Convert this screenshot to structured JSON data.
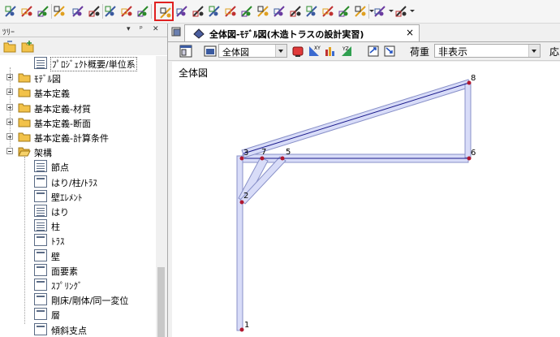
{
  "toolbar": {
    "buttons": [
      "grid-icon",
      "node-icon",
      "node-edit-icon",
      "delete-icon",
      "member-icon",
      "member-add-icon",
      "member-move-icon",
      "member-split-icon",
      "member-join-icon",
      "member-active-icon",
      "truss-icon",
      "brace-icon",
      "load-icon",
      "hinge-icon",
      "panel-icon",
      "arc-icon",
      "slab-icon",
      "view-icon",
      "section-icon",
      "load-case-icon",
      "print-icon",
      "property-icon",
      "axis-icon",
      "coord-icon"
    ],
    "active_index": 9
  },
  "tree_panel": {
    "title": "ﾂﾘｰ",
    "controls": [
      "▾",
      "ᵖ",
      "✕"
    ],
    "items": [
      {
        "label": "ﾌﾟﾛｼﾞｪｸﾄ概要/単位系",
        "level": 1,
        "type": "doc-lines",
        "expander": "none",
        "selected": true
      },
      {
        "label": "ﾓﾃﾞﾙ図",
        "level": 0,
        "type": "folder",
        "expander": "plus"
      },
      {
        "label": "基本定義",
        "level": 0,
        "type": "folder",
        "expander": "plus"
      },
      {
        "label": "基本定義-材質",
        "level": 0,
        "type": "folder",
        "expander": "plus"
      },
      {
        "label": "基本定義-断面",
        "level": 0,
        "type": "folder",
        "expander": "plus"
      },
      {
        "label": "基本定義-計算条件",
        "level": 0,
        "type": "folder",
        "expander": "plus"
      },
      {
        "label": "架構",
        "level": 0,
        "type": "folder-open",
        "expander": "minus"
      },
      {
        "label": "節点",
        "level": 1,
        "type": "doc-lines",
        "expander": "none"
      },
      {
        "label": "はり/柱/ﾄﾗｽ",
        "level": 1,
        "type": "doc",
        "expander": "none"
      },
      {
        "label": "壁ｴﾚﾒﾝﾄ",
        "level": 1,
        "type": "doc",
        "expander": "none"
      },
      {
        "label": "はり",
        "level": 1,
        "type": "doc-lines",
        "expander": "none"
      },
      {
        "label": "柱",
        "level": 1,
        "type": "doc-lines",
        "expander": "none"
      },
      {
        "label": "ﾄﾗｽ",
        "level": 1,
        "type": "doc",
        "expander": "none"
      },
      {
        "label": "壁",
        "level": 1,
        "type": "doc",
        "expander": "none"
      },
      {
        "label": "面要素",
        "level": 1,
        "type": "doc",
        "expander": "none"
      },
      {
        "label": "ｽﾌﾟﾘﾝｸﾞ",
        "level": 1,
        "type": "doc",
        "expander": "none"
      },
      {
        "label": "剛床/剛体/同一変位",
        "level": 1,
        "type": "doc",
        "expander": "none"
      },
      {
        "label": "層",
        "level": 1,
        "type": "doc",
        "expander": "none"
      },
      {
        "label": "傾斜支点",
        "level": 1,
        "type": "doc",
        "expander": "none"
      }
    ]
  },
  "document_tab": {
    "title": "全体図-ﾓﾃﾞﾙ図(木造トラスの設計実習)",
    "close": "×"
  },
  "view_toolbar": {
    "view_select": "全体図",
    "load_label": "荷重",
    "load_select": "非表示",
    "extra_label": "応"
  },
  "canvas": {
    "label": "全体図",
    "nodes": [
      "1",
      "2",
      "3",
      "5",
      "6",
      "7",
      "8"
    ]
  },
  "colors": {
    "member_fill": "#d8dcf8",
    "member_stroke": "#8890c8",
    "node_color": "#b01830",
    "accent_red": "#e02020"
  }
}
